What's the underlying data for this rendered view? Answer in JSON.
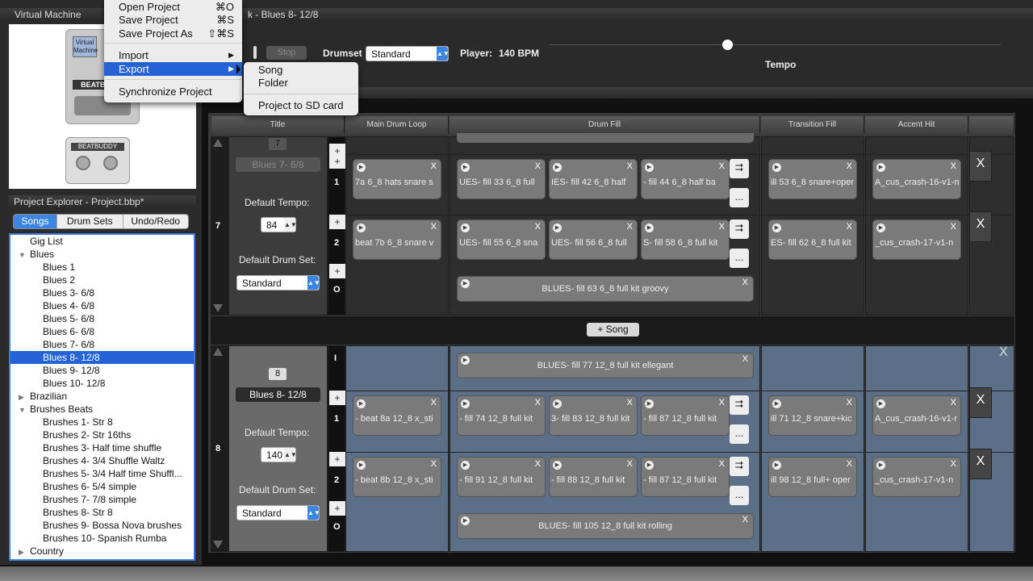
{
  "vm": {
    "title": "Virtual Machine"
  },
  "explorer": {
    "title": "Project Explorer - Project.bbp*",
    "tabs": [
      "Songs",
      "Drum Sets",
      "Undo/Redo"
    ],
    "tree": [
      {
        "label": "Gig List",
        "level": 0,
        "arrow": ""
      },
      {
        "label": "Blues",
        "level": 0,
        "arrow": "▼"
      },
      {
        "label": "Blues 1",
        "level": 1
      },
      {
        "label": "Blues 2",
        "level": 1
      },
      {
        "label": "Blues 3- 6/8",
        "level": 1
      },
      {
        "label": "Blues 4- 6/8",
        "level": 1
      },
      {
        "label": "Blues 5- 6/8",
        "level": 1
      },
      {
        "label": "Blues 6- 6/8",
        "level": 1
      },
      {
        "label": "Blues 7- 6/8",
        "level": 1
      },
      {
        "label": "Blues 8- 12/8",
        "level": 1,
        "selected": true
      },
      {
        "label": "Blues 9- 12/8",
        "level": 1
      },
      {
        "label": "Blues 10- 12/8",
        "level": 1
      },
      {
        "label": "Brazilian",
        "level": 0,
        "arrow": "▶"
      },
      {
        "label": "Brushes Beats",
        "level": 0,
        "arrow": "▼"
      },
      {
        "label": "Brushes 1- Str 8",
        "level": 1
      },
      {
        "label": "Brushes 2- Str 16ths",
        "level": 1
      },
      {
        "label": "Brushes 3- Half time shuffle",
        "level": 1
      },
      {
        "label": "Brushes 4- 3/4 Shuffle Waltz",
        "level": 1
      },
      {
        "label": "Brushes 5- 3/4 Half time Shuffl...",
        "level": 1
      },
      {
        "label": "Brushes 6- 5/4 simple",
        "level": 1
      },
      {
        "label": "Brushes 7- 7/8 simple",
        "level": 1
      },
      {
        "label": "Brushes 8- Str 8",
        "level": 1
      },
      {
        "label": "Brushes 9- Bossa Nova brushes",
        "level": 1
      },
      {
        "label": "Brushes 10- Spanish Rumba",
        "level": 1
      },
      {
        "label": "Country",
        "level": 0,
        "arrow": "▶"
      }
    ]
  },
  "top": {
    "title_frag": "k - Blues 8- 12/8",
    "stop": "Stop",
    "drumset_label": "Drumset",
    "drumset_value": "Standard",
    "player_label": "Player:",
    "player_value": "140 BPM",
    "tempo_label": "Tempo"
  },
  "menu": {
    "items": [
      {
        "label": "Open Project",
        "sc": "⌘O"
      },
      {
        "label": "Save Project",
        "sc": "⌘S"
      },
      {
        "label": "Save Project As",
        "sc": "⇧⌘S"
      },
      {
        "label": "Import",
        "sc": "▶"
      },
      {
        "label": "Export",
        "sc": "▶"
      },
      {
        "label": "Synchronize Project",
        "sc": ""
      }
    ],
    "submenu": [
      "Song",
      "Folder",
      "Project to SD card"
    ]
  },
  "headers": [
    "Title",
    "Main Drum Loop",
    "Drum Fill",
    "Transition Fill",
    "Accent Hit"
  ],
  "song7": {
    "num": "7",
    "badge": "7",
    "name": "Blues 7- 6/8",
    "tempo_label": "Default Tempo:",
    "tempo": "84",
    "drumset_label": "Default Drum Set:",
    "drumset": "Standard",
    "p1": {
      "label": "1",
      "main": "7a 6_8 hats snare s",
      "fills": [
        "UES- fill 33 6_8 full",
        "IES- fill 42 6_8 half",
        "- fill 44 6_8 half ba"
      ],
      "trans": "ill 53 6_8 snare+oper",
      "accent": "A_cus_crash-16-v1-n"
    },
    "p2": {
      "label": "2",
      "main": "beat 7b 6_8 snare v",
      "fills": [
        "UES- fill 55 6_8 sna",
        "UES- fill 56 6_8 full",
        "S- fill 58 6_8 full kit"
      ],
      "trans": "ES- fill 62 6_8 full kit",
      "accent": "_cus_crash-17-v1-n"
    },
    "outro": "BLUES- fill 63 6_8 full kit groovy",
    "o": "O"
  },
  "add_song": "+ Song",
  "song8": {
    "num": "8",
    "badge": "8",
    "name": "Blues 8- 12/8",
    "tempo_label": "Default Tempo:",
    "tempo": "140",
    "drumset_label": "Default Drum Set:",
    "drumset": "Standard",
    "intro": "BLUES- fill 77 12_8 full kit ellegant",
    "i": "I",
    "p1": {
      "label": "1",
      "main": "- beat 8a 12_8 x_sti",
      "fills": [
        "- fill 74 12_8 full kit",
        "3- fill 83 12_8 full kit",
        "- fill 87 12_8 full kit"
      ],
      "trans": "ill 71 12_8 snare+kic",
      "accent": "A_cus_crash-16-v1-r"
    },
    "p2": {
      "label": "2",
      "main": "- beat 8b 12_8 x_sti",
      "fills": [
        "- fill 91 12_8 full kit",
        "- fill 88 12_8 full kit",
        "- fill 87 12_8 full kit"
      ],
      "trans": "ill 98 12_8 full+ oper",
      "accent": "_cus_crash-17-v1-n"
    },
    "outro": "BLUES- fill 105 12_8 full kit rolling",
    "o": "O"
  },
  "icons": {
    "x": "X",
    "play": "▶",
    "transition": "⮆",
    "more": "...",
    "plus": "+"
  }
}
